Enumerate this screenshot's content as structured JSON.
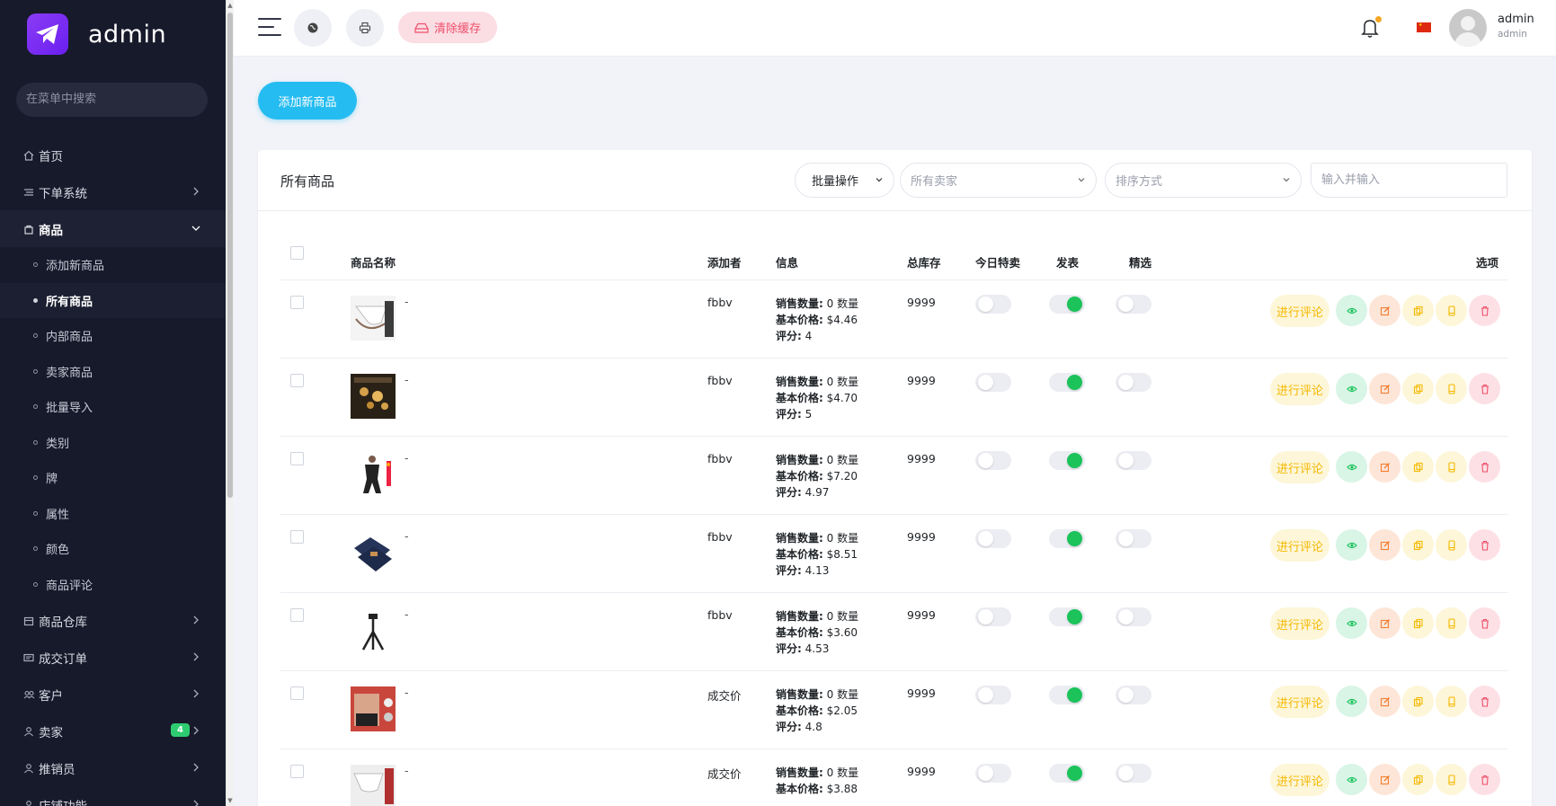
{
  "app": {
    "brand": "admin"
  },
  "sidebar": {
    "search_placeholder": "在菜单中搜索",
    "items": [
      {
        "label": "首页",
        "icon": "home-icon"
      },
      {
        "label": "下单系统",
        "icon": "list-icon"
      },
      {
        "label": "商品",
        "icon": "bag-icon"
      },
      {
        "label": "商品仓库",
        "icon": "warehouse-icon"
      },
      {
        "label": "成交订单",
        "icon": "order-icon"
      },
      {
        "label": "客户",
        "icon": "users-icon"
      },
      {
        "label": "卖家",
        "icon": "user-icon",
        "badge": "4"
      },
      {
        "label": "推销员",
        "icon": "user-icon"
      },
      {
        "label": "店铺功能",
        "icon": "shop-icon"
      }
    ],
    "sub_items": [
      "添加新商品",
      "所有商品",
      "内部商品",
      "卖家商品",
      "批量导入",
      "类别",
      "牌",
      "属性",
      "颜色",
      "商品评论"
    ]
  },
  "header": {
    "clear_cache": "清除缓存",
    "user_name": "admin",
    "user_role": "admin"
  },
  "main": {
    "add_button": "添加新商品",
    "card_title": "所有商品",
    "bulk_action": "批量操作",
    "seller_placeholder": "所有卖家",
    "sort_placeholder": "排序方式",
    "search_placeholder": "输入并输入",
    "columns": [
      "商品名称",
      "添加者",
      "信息",
      "总库存",
      "今日特卖",
      "发表",
      "精选",
      "选项"
    ],
    "info_labels": {
      "sold": "销售数量:",
      "sold_unit": " 数量",
      "price": "基本价格:",
      "rating": "评分:"
    },
    "review_label": "进行评论",
    "rows": [
      {
        "name": "-",
        "added_by": "fbbv",
        "sold": "0",
        "price": "$4.46",
        "rating": "4",
        "stock": "9999",
        "today_deal": false,
        "published": true,
        "featured": false,
        "thumb": "underwear-white"
      },
      {
        "name": "-",
        "added_by": "fbbv",
        "sold": "0",
        "price": "$4.70",
        "rating": "5",
        "stock": "9999",
        "today_deal": false,
        "published": true,
        "featured": false,
        "thumb": "led-lights"
      },
      {
        "name": "-",
        "added_by": "fbbv",
        "sold": "0",
        "price": "$7.20",
        "rating": "4.97",
        "stock": "9999",
        "today_deal": false,
        "published": true,
        "featured": false,
        "thumb": "bodysuit"
      },
      {
        "name": "-",
        "added_by": "fbbv",
        "sold": "0",
        "price": "$8.51",
        "rating": "4.13",
        "stock": "9999",
        "today_deal": false,
        "published": true,
        "featured": false,
        "thumb": "jeans"
      },
      {
        "name": "-",
        "added_by": "fbbv",
        "sold": "0",
        "price": "$3.60",
        "rating": "4.53",
        "stock": "9999",
        "today_deal": false,
        "published": true,
        "featured": false,
        "thumb": "tripod"
      },
      {
        "name": "-",
        "added_by": "成交价",
        "sold": "0",
        "price": "$2.05",
        "rating": "4.8",
        "stock": "9999",
        "today_deal": false,
        "published": true,
        "featured": false,
        "thumb": "boxers"
      },
      {
        "name": "-",
        "added_by": "成交价",
        "sold": "0",
        "price": "$3.88",
        "rating": "",
        "stock": "9999",
        "today_deal": false,
        "published": true,
        "featured": false,
        "thumb": "briefs"
      }
    ]
  }
}
